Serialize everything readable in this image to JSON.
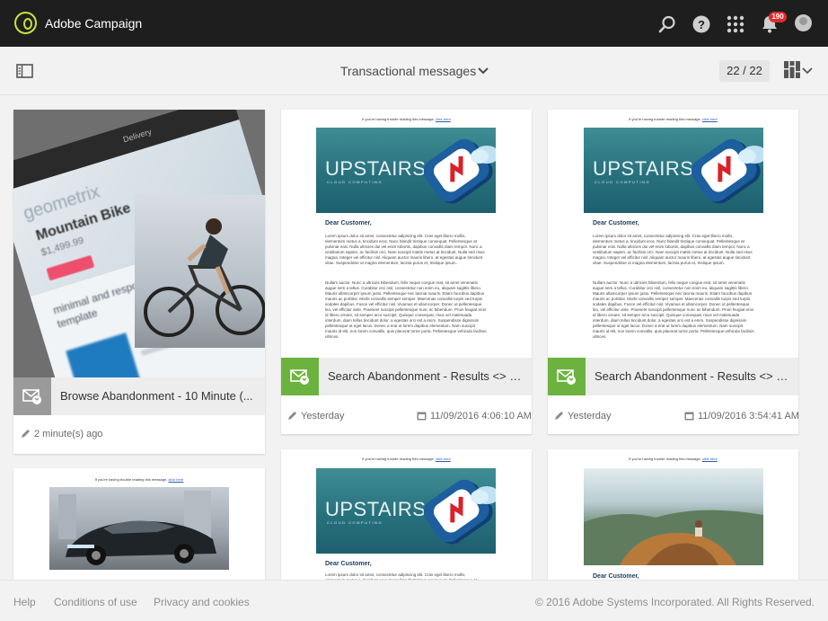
{
  "header": {
    "app_title": "Adobe Campaign",
    "notification_count": "190",
    "icons": [
      "adobe-campaign-logo",
      "search-icon",
      "help-icon",
      "apps-grid-icon",
      "bell-icon",
      "avatar"
    ]
  },
  "toolbar": {
    "view_title": "Transactional messages",
    "count": "22 / 22",
    "icons": [
      "side-panel-icon",
      "chevron-down-icon",
      "grid-view-icon"
    ]
  },
  "cards": [
    {
      "label": "Browse Abandonment - 10 Minute (...",
      "modified": "2 minute(s) ago",
      "icon_color": "#9a9a9a",
      "thumb_texts": [
        "Delivery",
        "geometrix",
        "Mountain Bike",
        "$1,499.99",
        "minimal and responsive marketing email template"
      ]
    },
    {
      "label": "Search Abandonment - Results <> N...",
      "modified": "Yesterday",
      "date": "11/09/2016 4:06:10 AM",
      "icon_color": "#6bb33e"
    },
    {
      "label": "Search Abandonment - Results <> N...",
      "modified": "Yesterday",
      "date": "11/09/2016 3:54:41 AM",
      "icon_color": "#6bb33e"
    }
  ],
  "email": {
    "notice": "If you're having trouble reading this message,",
    "notice_link": "click here",
    "brand": "UPSTAIRS",
    "brand_sub": "CLOUD COMPUTING",
    "greeting": "Dear Customer,",
    "para1": "Lorem ipsum dolor sit amet, consectetur adipiscing elit. Cras eget libero mollis, elementum metus a, tincidunt eros. Nunc blandit tristique consequat. Pellentesque at pulvinar erat. Nulla ultricies dui vel enim lobortis, dapibus convallis diam tempor. Nunc a vestibulum sapien, ac facilisis orci. Nam suscipit mattis metus at tincidunt. Nulla sed risus magna. Integer vel efficitur nisl. Aliquam auctor mauris libero, at egestas augue tincidunt vitae. Suspendisse ut magna elementum, lacinia purus et, tristique ipsum.",
    "para2": "Nullam auctor. Nunc a ultricies bibendum, felis neque congue erat, sit amet venenatis augue sem a tellus. Curabitur orci nisl, consectetur non enim eu, aliquam sagittis libero. Mauris ullamcorper ipsum justo. Pellentesque nec lacinia mauris. Etiam faucibus dapibus mauris ac porttitor. Morbi convallis semper semper. Maecenas convallis turpis sed turpis sodales dapibus. Fusce vel efficitur nisl. Vivamus et ullamcorper. Donec ut pellentesque leo, vel efficitur ante. Praesent suscipit pellentesque nunc ac bibendum. Proin feugiat eros id libero ornare, sit semper arcu suscipit. Quisque consequat, risus vel malesuada interdum, diam tellus tincidunt dolor, a egestas orci est a enim. Suspendisse dignissim pellentesque ut eget lacus. Donec a erat ut lorem dapibus elementum. Nam suscipit mauris id elit, non lorem convallis, quis placerat tortor porta. Pellentesque vehicula facilisis ultrices."
  },
  "footer": {
    "links": [
      "Help",
      "Conditions of use",
      "Privacy and cookies"
    ],
    "copyright": "© 2016 Adobe Systems Incorporated. All Rights Reserved."
  },
  "colors": {
    "topbar": "#1e1e1e",
    "accent_green": "#6bb33e",
    "logo_lime": "#c8e23c",
    "badge_red": "#e02c2c"
  }
}
